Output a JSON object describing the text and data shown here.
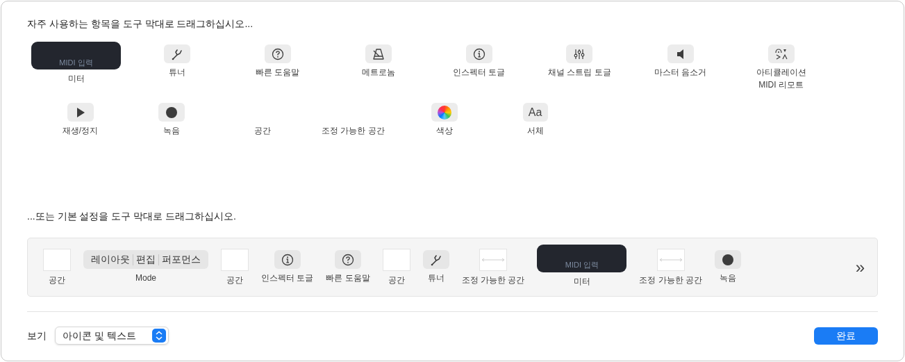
{
  "palette_heading": "자주 사용하는 항목을 도구 막대로 드래그하십시오...",
  "palette_rows": [
    [
      {
        "kind": "meter",
        "label": "미터",
        "caption": "MIDI 입력"
      },
      {
        "kind": "tuner",
        "label": "튜너"
      },
      {
        "kind": "help",
        "label": "빠른 도움말"
      },
      {
        "kind": "metronome",
        "label": "메트로놈"
      },
      {
        "kind": "info",
        "label": "인스펙터 토글"
      },
      {
        "kind": "mixer",
        "label": "채널 스트립 토글"
      },
      {
        "kind": "speaker",
        "label": "마스터 음소거"
      },
      {
        "kind": "articulation",
        "label": "아티큘레이션\nMIDI 리모트"
      }
    ],
    [
      {
        "kind": "play",
        "label": "재생/정지"
      },
      {
        "kind": "record",
        "label": "녹음"
      },
      {
        "kind": "space",
        "label": "공간"
      },
      {
        "kind": "flex_space",
        "label": "조정 가능한 공간"
      },
      {
        "kind": "color",
        "label": "색상"
      },
      {
        "kind": "glyph",
        "glyph": "Aa",
        "label": "서체"
      }
    ]
  ],
  "default_heading": "...또는 기본 설정을 도구 막대로 드래그하십시오.",
  "default_toolbar": [
    {
      "kind": "space",
      "label": "공간"
    },
    {
      "kind": "mode",
      "segments": [
        "레이아웃",
        "편집",
        "퍼포먼스"
      ],
      "label": "Mode"
    },
    {
      "kind": "space",
      "label": "공간"
    },
    {
      "kind": "info",
      "label": "인스펙터 토글"
    },
    {
      "kind": "help",
      "label": "빠른 도움말"
    },
    {
      "kind": "space",
      "label": "공간"
    },
    {
      "kind": "tuner",
      "label": "튜너"
    },
    {
      "kind": "flex_space",
      "label": "조정 가능한 공간"
    },
    {
      "kind": "meter",
      "label": "미터",
      "caption": "MIDI 입력"
    },
    {
      "kind": "flex_space",
      "label": "조정 가능한 공간"
    },
    {
      "kind": "record",
      "label": "녹음"
    }
  ],
  "overflow": "»",
  "footer": {
    "view_label": "보기",
    "view_value": "아이콘 및 텍스트",
    "done_button": "완료"
  }
}
